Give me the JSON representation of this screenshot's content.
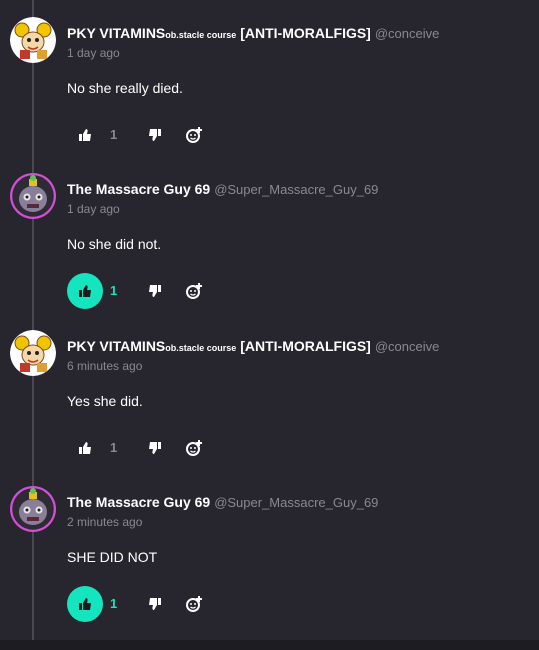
{
  "comments": [
    {
      "username": "PKY VITAMINS",
      "username_smallcaps": "ob.stacle course",
      "username_suffix": " [ANTI-MORALFIGS]",
      "handle": "@conceive",
      "timestamp": "1 day ago",
      "text": "No she really died.",
      "likes": "1",
      "liked": false,
      "avatar_icon": "mouse-cartoon-avatar"
    },
    {
      "username": "The Massacre Guy 69",
      "username_smallcaps": "",
      "username_suffix": "",
      "handle": "@Super_Massacre_Guy_69",
      "timestamp": "1 day ago",
      "text": "No she did not.",
      "likes": "1",
      "liked": true,
      "avatar_icon": "animatronic-avatar"
    },
    {
      "username": "PKY VITAMINS",
      "username_smallcaps": "ob.stacle course",
      "username_suffix": " [ANTI-MORALFIGS]",
      "handle": "@conceive",
      "timestamp": "6 minutes ago",
      "text": "Yes she did.",
      "likes": "1",
      "liked": false,
      "avatar_icon": "mouse-cartoon-avatar"
    },
    {
      "username": "The Massacre Guy 69",
      "username_smallcaps": "",
      "username_suffix": "",
      "handle": "@Super_Massacre_Guy_69",
      "timestamp": "2 minutes ago",
      "text": "SHE DID NOT",
      "likes": "1",
      "liked": true,
      "avatar_icon": "animatronic-avatar"
    }
  ],
  "colors": {
    "background": "#27252d",
    "accent": "#15e5bf",
    "muted": "#8a8890",
    "avatar_ring": "#d34fd3"
  }
}
